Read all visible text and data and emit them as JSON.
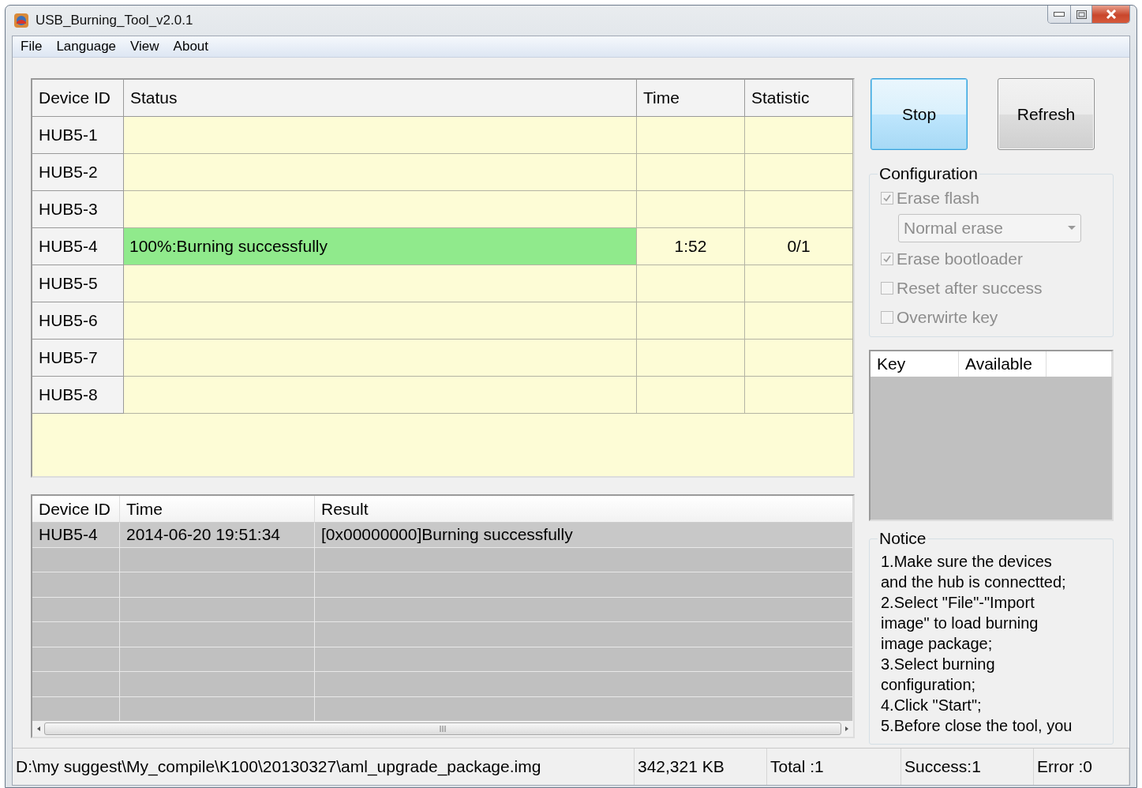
{
  "window": {
    "title": "USB_Burning_Tool_v2.0.1"
  },
  "menu": [
    "File",
    "Language",
    "View",
    "About"
  ],
  "device_table": {
    "columns": [
      "Device ID",
      "Status",
      "Time",
      "Statistic"
    ],
    "rows": [
      {
        "device_id": "HUB5-1",
        "status": "",
        "time": "",
        "statistic": "",
        "kind": "idle"
      },
      {
        "device_id": "HUB5-2",
        "kind": "idle"
      },
      {
        "device_id": "HUB5-3",
        "kind": "idle"
      },
      {
        "device_id": "HUB5-4",
        "status": "100%:Burning successfully",
        "time": "1:52",
        "statistic": "0/1",
        "kind": "success"
      },
      {
        "device_id": "HUB5-5",
        "kind": "idle"
      },
      {
        "device_id": "HUB5-6",
        "kind": "idle"
      },
      {
        "device_id": "HUB5-7",
        "kind": "idle"
      },
      {
        "device_id": "HUB5-8",
        "kind": "idle"
      }
    ]
  },
  "log_table": {
    "columns": [
      "Device ID",
      "Time",
      "Result"
    ],
    "rows": [
      {
        "device_id": "HUB5-4",
        "time": "2014-06-20 19:51:34",
        "result": "[0x00000000]Burning successfully"
      }
    ]
  },
  "buttons": [
    {
      "label": "Stop",
      "focused": true
    },
    {
      "label": "Refresh",
      "focused": false
    }
  ],
  "configuration": {
    "title": "Configuration",
    "disabled": true,
    "options": [
      {
        "kind": "checkbox",
        "label": "Erase flash",
        "checked": true
      },
      {
        "kind": "dropdown",
        "value": "Normal erase"
      },
      {
        "kind": "checkbox",
        "label": "Erase bootloader",
        "checked": true
      },
      {
        "kind": "checkbox",
        "label": "Reset after success",
        "checked": false
      },
      {
        "kind": "checkbox",
        "label": "Overwirte key",
        "checked": false
      }
    ]
  },
  "key_table": {
    "columns": [
      "Key",
      "Available"
    ]
  },
  "notice": {
    "title": "Notice",
    "lines": [
      "1.Make sure the devices",
      "and the hub is connectted;",
      "2.Select \"File\"-\"Import",
      "image\" to load burning",
      "image package;",
      "3.Select burning",
      "configuration;",
      "4.Click \"Start\";",
      "5.Before close the tool, you"
    ]
  },
  "status_bar": [
    "D:\\my suggest\\My_compile\\K100\\20130327\\aml_upgrade_package.img",
    "342,321 KB",
    "Total :1",
    "Success:1",
    "Error :0"
  ]
}
